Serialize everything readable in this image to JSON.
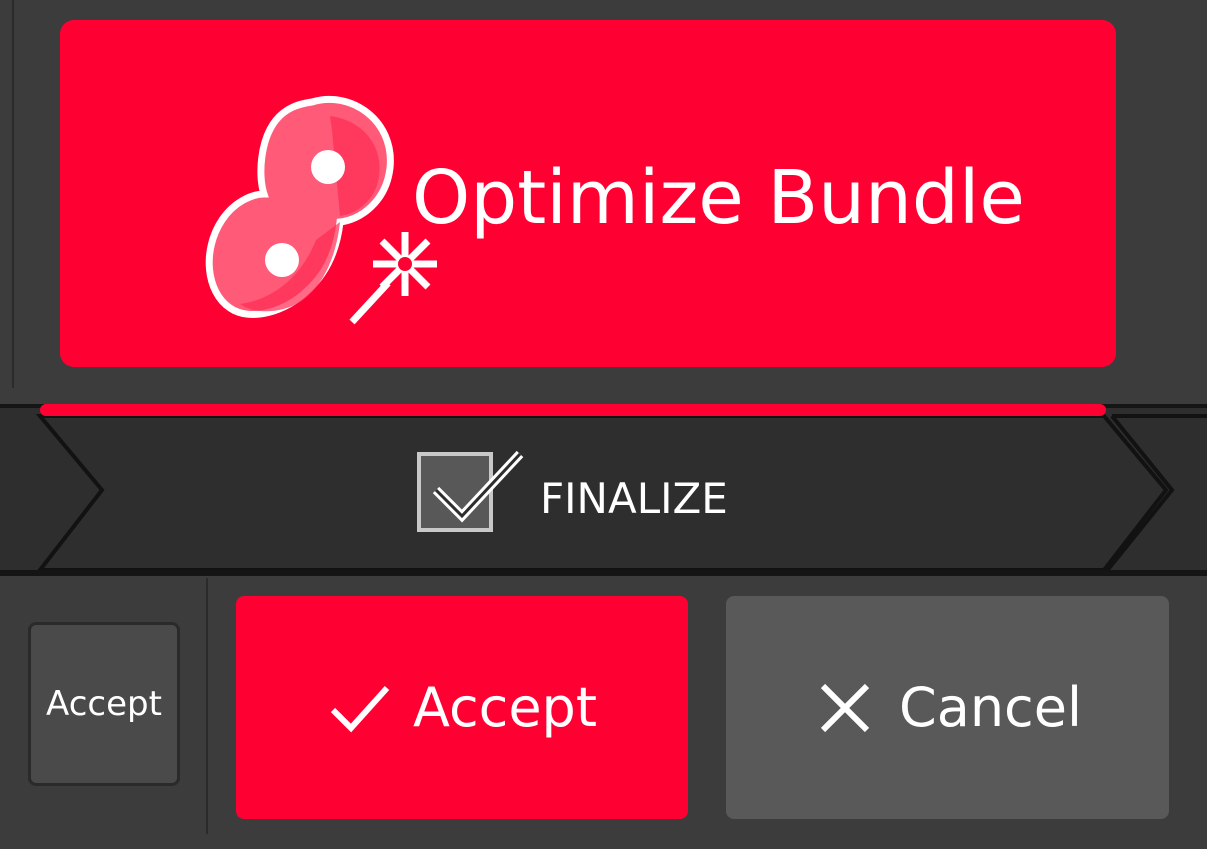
{
  "optimize": {
    "label": "Optimize Bundle",
    "icon": "bundle-optimize-icon",
    "color": "#ff0033"
  },
  "step": {
    "label": "FINALIZE",
    "icon": "checkbox-checked-icon",
    "checked": true
  },
  "actions": {
    "small_accept_label": "Accept",
    "accept_label": "Accept",
    "accept_icon": "checkmark-icon",
    "cancel_label": "Cancel",
    "cancel_icon": "close-icon"
  },
  "colors": {
    "accent": "#ff0033",
    "background": "#3c3c3c",
    "band": "#2e2e2e",
    "cancel": "#595959"
  }
}
